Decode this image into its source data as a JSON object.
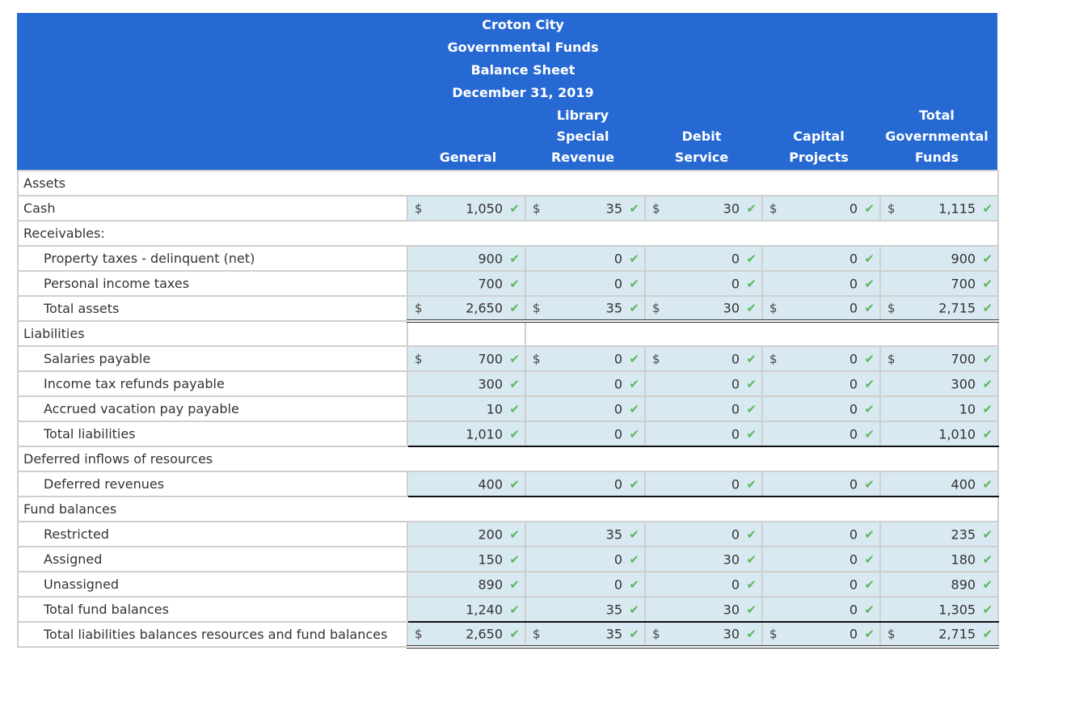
{
  "header": {
    "title_lines": [
      "Croton City",
      "Governmental Funds",
      "Balance Sheet",
      "December 31, 2019"
    ],
    "columns": [
      {
        "lines": [
          "General"
        ]
      },
      {
        "lines": [
          "Library",
          "Special",
          "Revenue"
        ]
      },
      {
        "lines": [
          "Debit",
          "Service"
        ]
      },
      {
        "lines": [
          "Capital",
          "Projects"
        ]
      },
      {
        "lines": [
          "Total",
          "Governmental",
          "Funds"
        ]
      }
    ]
  },
  "currency_symbol": "$",
  "check_icon": "✔",
  "colors": {
    "header_bg": "#2769d3",
    "cell_bg": "#d9e9f1",
    "check": "#5cb85c"
  },
  "rows": [
    {
      "label": "Assets",
      "type": "section"
    },
    {
      "label": "Cash",
      "type": "value",
      "dollar": true,
      "values": [
        "1,050",
        "35",
        "30",
        "0",
        "1,115"
      ]
    },
    {
      "label": "Receivables:",
      "type": "section"
    },
    {
      "label": "Property taxes - delinquent (net)",
      "type": "value",
      "indent": true,
      "values": [
        "900",
        "0",
        "0",
        "0",
        "900"
      ]
    },
    {
      "label": "Personal income taxes",
      "type": "value",
      "indent": true,
      "values": [
        "700",
        "0",
        "0",
        "0",
        "700"
      ]
    },
    {
      "label": "Total assets",
      "type": "value",
      "indent": true,
      "dollar": true,
      "topline": true,
      "double": true,
      "values": [
        "2,650",
        "35",
        "30",
        "0",
        "2,715"
      ]
    },
    {
      "label": "Liabilities",
      "type": "section-blankcells"
    },
    {
      "label": "Salaries payable",
      "type": "value",
      "indent": true,
      "dollar": true,
      "values": [
        "700",
        "0",
        "0",
        "0",
        "700"
      ]
    },
    {
      "label": "Income tax refunds payable",
      "type": "value",
      "indent": true,
      "values": [
        "300",
        "0",
        "0",
        "0",
        "300"
      ]
    },
    {
      "label": "Accrued vacation pay payable",
      "type": "value",
      "indent": true,
      "values": [
        "10",
        "0",
        "0",
        "0",
        "10"
      ]
    },
    {
      "label": "Total liabilities",
      "type": "value",
      "indent": true,
      "topline": true,
      "bottomline": true,
      "values": [
        "1,010",
        "0",
        "0",
        "0",
        "1,010"
      ]
    },
    {
      "label": "Deferred inflows of resources",
      "type": "section"
    },
    {
      "label": "Deferred revenues",
      "type": "value",
      "indent": true,
      "bottomline": true,
      "values": [
        "400",
        "0",
        "0",
        "0",
        "400"
      ]
    },
    {
      "label": "Fund balances",
      "type": "section"
    },
    {
      "label": "Restricted",
      "type": "value",
      "indent": true,
      "values": [
        "200",
        "35",
        "0",
        "0",
        "235"
      ]
    },
    {
      "label": "Assigned",
      "type": "value",
      "indent": true,
      "values": [
        "150",
        "0",
        "30",
        "0",
        "180"
      ]
    },
    {
      "label": "Unassigned",
      "type": "value",
      "indent": true,
      "values": [
        "890",
        "0",
        "0",
        "0",
        "890"
      ]
    },
    {
      "label": "Total fund balances",
      "type": "value",
      "indent": true,
      "topline": true,
      "bottomline": true,
      "values": [
        "1,240",
        "35",
        "30",
        "0",
        "1,305"
      ]
    },
    {
      "label": "Total liabilities balances resources and fund balances",
      "type": "value",
      "indent": true,
      "dollar": true,
      "double": true,
      "values": [
        "2,650",
        "35",
        "30",
        "0",
        "2,715"
      ]
    }
  ]
}
